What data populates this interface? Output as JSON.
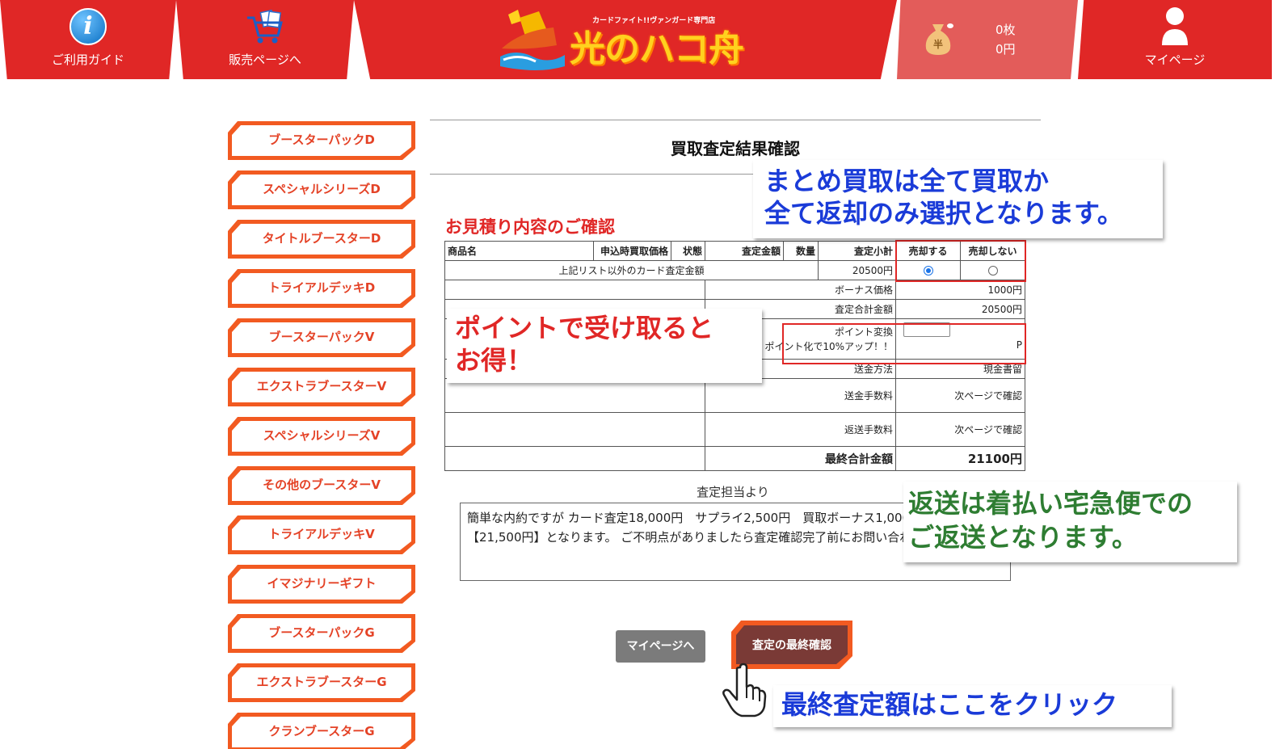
{
  "header": {
    "guide_label": "ご利用ガイド",
    "shop_label": "販売ページへ",
    "logo_text": "光のハコ舟",
    "logo_subtitle": "カードファイト!!ヴァンガード専門店",
    "cart_count": "0枚",
    "cart_amount": "0円",
    "bag_glyph": "半",
    "mypage_label": "マイページ"
  },
  "sidebar": {
    "items": [
      {
        "label": "ブースターパックD"
      },
      {
        "label": "スペシャルシリーズD"
      },
      {
        "label": "タイトルブースターD"
      },
      {
        "label": "トライアルデッキD"
      },
      {
        "label": "ブースターパックV"
      },
      {
        "label": "エクストラブースターV"
      },
      {
        "label": "スペシャルシリーズV"
      },
      {
        "label": "その他のブースターV"
      },
      {
        "label": "トライアルデッキV"
      },
      {
        "label": "イマジナリーギフト"
      },
      {
        "label": "ブースターパックG"
      },
      {
        "label": "エクストラブースターG"
      },
      {
        "label": "クランブースターG"
      }
    ]
  },
  "main": {
    "page_title": "買取査定結果確認",
    "section_title": "お見積り内容のご確認",
    "table": {
      "headers": [
        "商品名",
        "申込時買取価格",
        "状態",
        "査定金額",
        "数量",
        "査定小計",
        "売却する",
        "売却しない"
      ],
      "item_row": {
        "name": "上記リスト以外のカード査定金額",
        "subtotal": "20500円"
      },
      "bonus_label": "ボーナス価格",
      "bonus_value": "1000円",
      "total_label": "査定合計金額",
      "total_value": "20500円",
      "point_label": "ポイント変換",
      "point_note": "ポイント化で10%アップ！！",
      "point_unit": "P",
      "send_method_label": "送金方法",
      "send_method_value": "現金書留",
      "send_fee_label": "送金手数料",
      "send_fee_value": "次ページで確認",
      "return_fee_label": "返送手数料",
      "return_fee_value": "次ページで確認",
      "final_label": "最終合計金額",
      "final_value": "21100円"
    },
    "staff_label": "査定担当より",
    "staff_message": "簡単な内約ですが カード査定18,000円　サプライ2,500円　買取ボーナス1,000円 合計【21,500円】となります。 ご不明点がありましたら査定確認完了前にお問い合わせ下さい。",
    "mypage_button": "マイページへ",
    "final_confirm_button": "査定の最終確認"
  },
  "callouts": {
    "bulk": [
      "まとめ買取は全て買取か",
      "全て返却のみ選択となります。"
    ],
    "points": [
      "ポイントで受け取ると",
      "お得！"
    ],
    "return": [
      "返送は着払い宅急便での",
      "ご返送となります。"
    ],
    "click": "最終査定額はここをクリック"
  },
  "colors": {
    "header_red": "#e02726",
    "sidebar_orange": "#f25a21",
    "final_button": "#7a3a36",
    "callout_blue": "#1a3bd8",
    "callout_red": "#e02726",
    "callout_green": "#2e7d32"
  }
}
